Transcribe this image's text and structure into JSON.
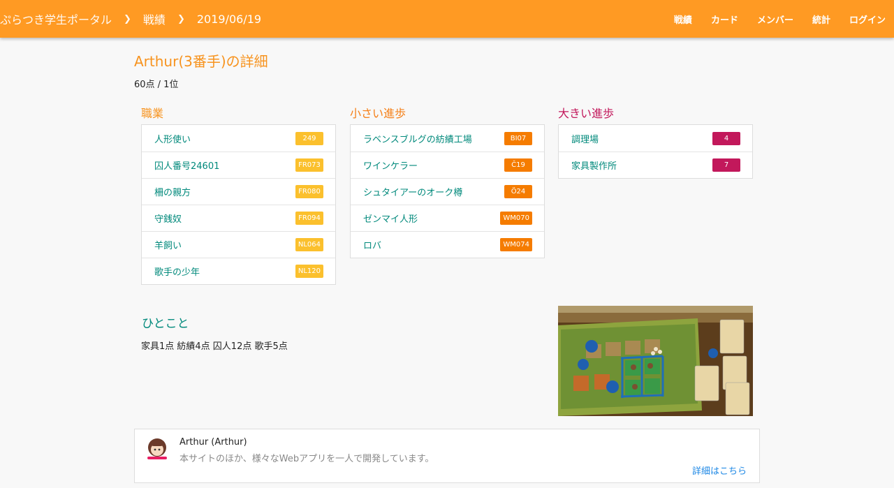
{
  "header": {
    "breadcrumb": [
      "ぷらつき学生ポータル",
      "戦績",
      "2019/06/19"
    ],
    "nav": [
      "戦績",
      "カード",
      "メンバー",
      "統計",
      "ログイン"
    ]
  },
  "player": {
    "title": "Arthur(3番手)の詳細",
    "score": "60点 / 1位"
  },
  "occupations": {
    "heading": "職業",
    "items": [
      {
        "name": "人形使い",
        "code": "249"
      },
      {
        "name": "囚人番号24601",
        "code": "FR073"
      },
      {
        "name": "柵の親方",
        "code": "FR080"
      },
      {
        "name": "守銭奴",
        "code": "FR094"
      },
      {
        "name": "羊飼い",
        "code": "NL064"
      },
      {
        "name": "歌手の少年",
        "code": "NL120"
      }
    ]
  },
  "minor": {
    "heading": "小さい進歩",
    "items": [
      {
        "name": "ラベンスブルグの紡績工場",
        "code": "BI07"
      },
      {
        "name": "ワインケラー",
        "code": "Č19"
      },
      {
        "name": "シュタイアーのオーク樽",
        "code": "Ö24"
      },
      {
        "name": "ゼンマイ人形",
        "code": "WM070"
      },
      {
        "name": "ロバ",
        "code": "WM074"
      }
    ]
  },
  "major": {
    "heading": "大きい進歩",
    "items": [
      {
        "name": "調理場",
        "code": "4"
      },
      {
        "name": "家具製作所",
        "code": "7"
      }
    ]
  },
  "comment": {
    "heading": "ひとこと",
    "text": "家具1点 紡績4点 囚人12点 歌手5点"
  },
  "profile": {
    "name": "Arthur (Arthur)",
    "description": "本サイトのほか、様々なWebアプリを一人で開発しています。",
    "link": "詳細はこちら"
  }
}
